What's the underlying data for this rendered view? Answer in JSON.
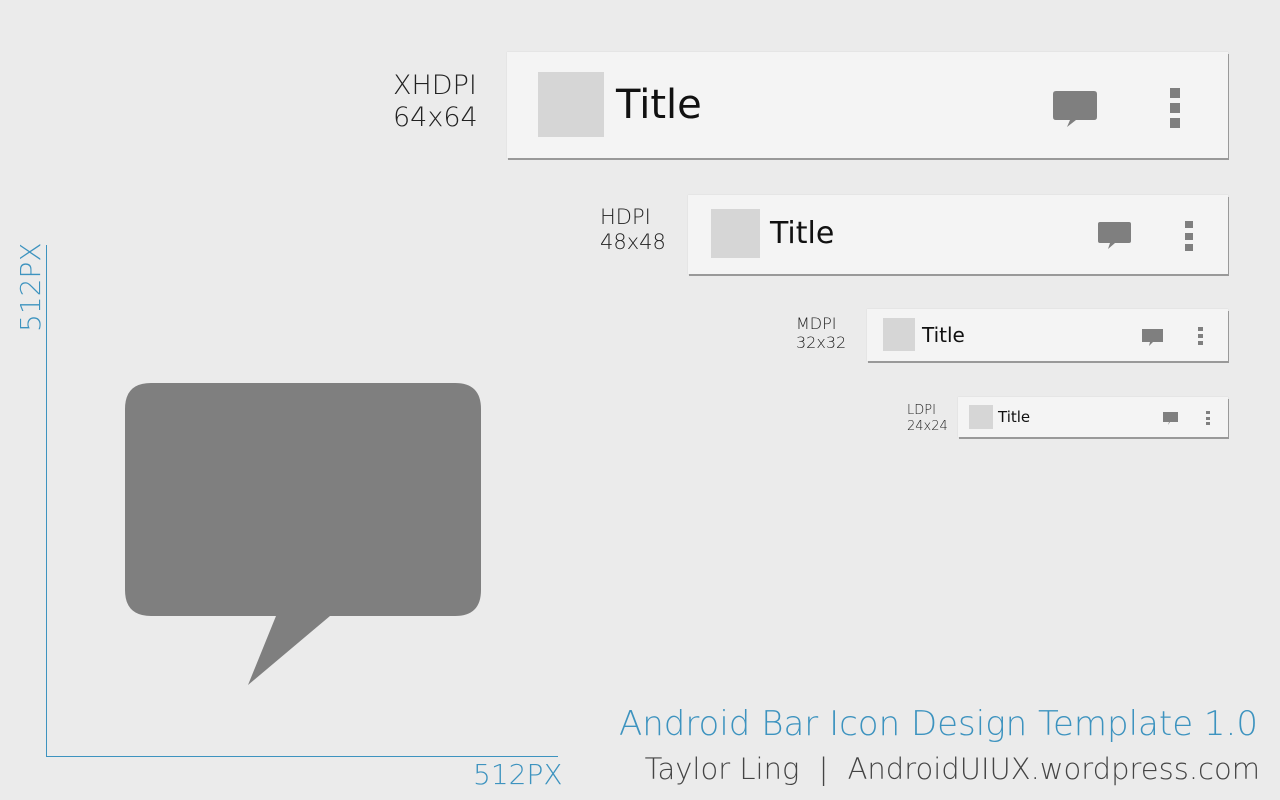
{
  "page": {
    "background": "#ebebeb",
    "accent_color": "#3d93bf",
    "icon_color": "#7f7f7f"
  },
  "densities": [
    {
      "name": "XHDPI",
      "size": "64x64",
      "bar_title": "Title"
    },
    {
      "name": "HDPI",
      "size": "48x48",
      "bar_title": "Title"
    },
    {
      "name": "MDPI",
      "size": "32x32",
      "bar_title": "Title"
    },
    {
      "name": "LDPI",
      "size": "24x24",
      "bar_title": "Title"
    }
  ],
  "canvas": {
    "width_label": "512PX",
    "height_label": "512PX",
    "icon": "chat-bubble-icon"
  },
  "bar_icons": [
    "app-icon-placeholder",
    "chat-bubble-icon",
    "overflow-menu-icon"
  ],
  "footer": {
    "title": "Android Bar Icon Design Template 1.0",
    "author": "Taylor Ling",
    "separator": "|",
    "site": "AndroidUIUX.wordpress.com"
  }
}
